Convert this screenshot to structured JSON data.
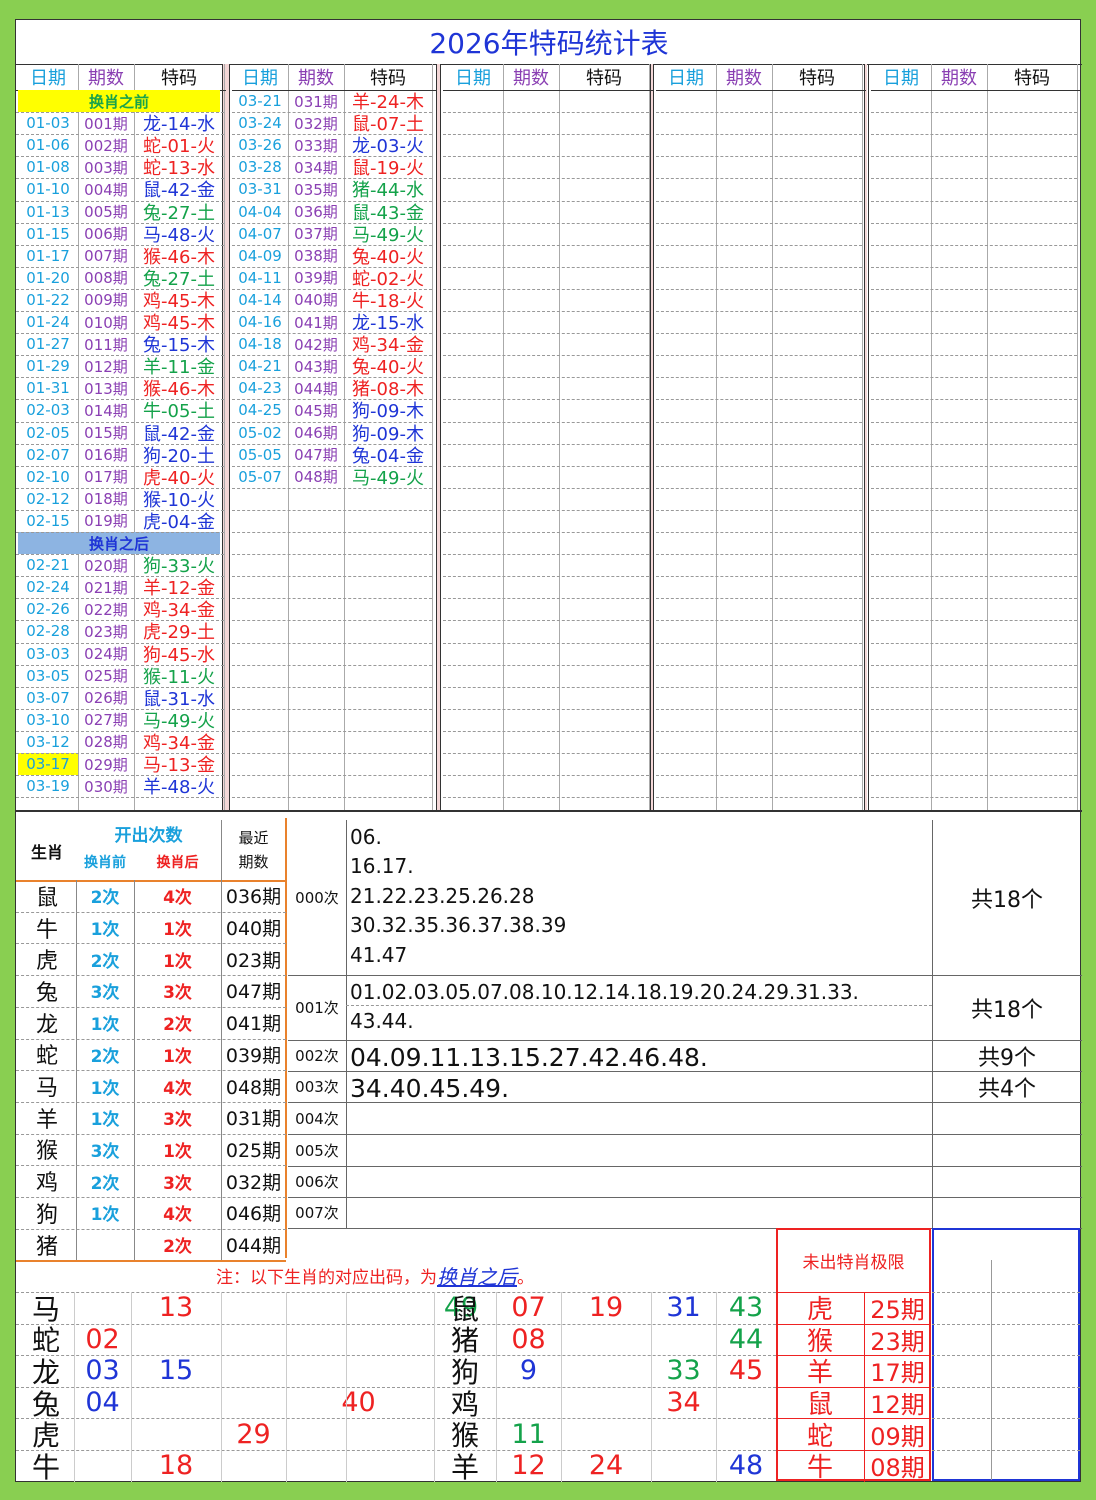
{
  "title": "2026年特码统计表",
  "header": {
    "date": "日期",
    "period": "期数",
    "code": "特码"
  },
  "banner_before": "换肖之前",
  "banner_after": "换肖之后",
  "colors": {
    "blue": "#1f35d6",
    "red": "#ee2222",
    "green": "#14a24a",
    "cyan": "#19a0dc",
    "purple": "#8a3fb3",
    "banner_yellow": "#ffff00",
    "banner_blue": "#8db4e2",
    "frame_green": "#89cf51"
  },
  "col1": [
    {
      "date": "01-03",
      "period": "001期",
      "code": "龙-14-水",
      "color": "blue"
    },
    {
      "date": "01-06",
      "period": "002期",
      "code": "蛇-01-火",
      "color": "red"
    },
    {
      "date": "01-08",
      "period": "003期",
      "code": "蛇-13-水",
      "color": "red"
    },
    {
      "date": "01-10",
      "period": "004期",
      "code": "鼠-42-金",
      "color": "blue"
    },
    {
      "date": "01-13",
      "period": "005期",
      "code": "兔-27-土",
      "color": "green"
    },
    {
      "date": "01-15",
      "period": "006期",
      "code": "马-48-火",
      "color": "blue"
    },
    {
      "date": "01-17",
      "period": "007期",
      "code": "猴-46-木",
      "color": "red"
    },
    {
      "date": "01-20",
      "period": "008期",
      "code": "兔-27-土",
      "color": "green"
    },
    {
      "date": "01-22",
      "period": "009期",
      "code": "鸡-45-木",
      "color": "red"
    },
    {
      "date": "01-24",
      "period": "010期",
      "code": "鸡-45-木",
      "color": "red"
    },
    {
      "date": "01-27",
      "period": "011期",
      "code": "兔-15-木",
      "color": "blue"
    },
    {
      "date": "01-29",
      "period": "012期",
      "code": "羊-11-金",
      "color": "green"
    },
    {
      "date": "01-31",
      "period": "013期",
      "code": "猴-46-木",
      "color": "red"
    },
    {
      "date": "02-03",
      "period": "014期",
      "code": "牛-05-土",
      "color": "green"
    },
    {
      "date": "02-05",
      "period": "015期",
      "code": "鼠-42-金",
      "color": "blue"
    },
    {
      "date": "02-07",
      "period": "016期",
      "code": "狗-20-土",
      "color": "blue"
    },
    {
      "date": "02-10",
      "period": "017期",
      "code": "虎-40-火",
      "color": "red"
    },
    {
      "date": "02-12",
      "period": "018期",
      "code": "猴-10-火",
      "color": "blue"
    },
    {
      "date": "02-15",
      "period": "019期",
      "code": "虎-04-金",
      "color": "blue"
    },
    {
      "date": "02-21",
      "period": "020期",
      "code": "狗-33-火",
      "color": "green"
    },
    {
      "date": "02-24",
      "period": "021期",
      "code": "羊-12-金",
      "color": "red"
    },
    {
      "date": "02-26",
      "period": "022期",
      "code": "鸡-34-金",
      "color": "red"
    },
    {
      "date": "02-28",
      "period": "023期",
      "code": "虎-29-土",
      "color": "red"
    },
    {
      "date": "03-03",
      "period": "024期",
      "code": "狗-45-水",
      "color": "red"
    },
    {
      "date": "03-05",
      "period": "025期",
      "code": "猴-11-火",
      "color": "green"
    },
    {
      "date": "03-07",
      "period": "026期",
      "code": "鼠-31-水",
      "color": "blue"
    },
    {
      "date": "03-10",
      "period": "027期",
      "code": "马-49-火",
      "color": "green"
    },
    {
      "date": "03-12",
      "period": "028期",
      "code": "鸡-34-金",
      "color": "red"
    },
    {
      "date": "03-17",
      "period": "029期",
      "code": "马-13-金",
      "color": "red",
      "highlight": true
    },
    {
      "date": "03-19",
      "period": "030期",
      "code": "羊-48-火",
      "color": "blue"
    }
  ],
  "col2": [
    {
      "date": "03-21",
      "period": "031期",
      "code": "羊-24-木",
      "color": "red"
    },
    {
      "date": "03-24",
      "period": "032期",
      "code": "鼠-07-土",
      "color": "red"
    },
    {
      "date": "03-26",
      "period": "033期",
      "code": "龙-03-火",
      "color": "blue"
    },
    {
      "date": "03-28",
      "period": "034期",
      "code": "鼠-19-火",
      "color": "red"
    },
    {
      "date": "03-31",
      "period": "035期",
      "code": "猪-44-水",
      "color": "green"
    },
    {
      "date": "04-04",
      "period": "036期",
      "code": "鼠-43-金",
      "color": "green"
    },
    {
      "date": "04-07",
      "period": "037期",
      "code": "马-49-火",
      "color": "green"
    },
    {
      "date": "04-09",
      "period": "038期",
      "code": "兔-40-火",
      "color": "red"
    },
    {
      "date": "04-11",
      "period": "039期",
      "code": "蛇-02-火",
      "color": "red"
    },
    {
      "date": "04-14",
      "period": "040期",
      "code": "牛-18-火",
      "color": "red"
    },
    {
      "date": "04-16",
      "period": "041期",
      "code": "龙-15-水",
      "color": "blue"
    },
    {
      "date": "04-18",
      "period": "042期",
      "code": "鸡-34-金",
      "color": "red"
    },
    {
      "date": "04-21",
      "period": "043期",
      "code": "兔-40-火",
      "color": "red"
    },
    {
      "date": "04-23",
      "period": "044期",
      "code": "猪-08-木",
      "color": "red"
    },
    {
      "date": "04-25",
      "period": "045期",
      "code": "狗-09-木",
      "color": "blue"
    },
    {
      "date": "05-02",
      "period": "046期",
      "code": "狗-09-木",
      "color": "blue"
    },
    {
      "date": "05-05",
      "period": "047期",
      "code": "兔-04-金",
      "color": "blue"
    },
    {
      "date": "05-07",
      "period": "048期",
      "code": "马-49-火",
      "color": "green"
    }
  ],
  "stats": {
    "zodiac_header": "生肖",
    "count_header": "开出次数",
    "before": "换肖前",
    "after": "换肖后",
    "recent1": "最近",
    "recent2": "期数",
    "rows": [
      {
        "z": "鼠",
        "b": "2次",
        "a": "4次",
        "r": "036期"
      },
      {
        "z": "牛",
        "b": "1次",
        "a": "1次",
        "r": "040期"
      },
      {
        "z": "虎",
        "b": "2次",
        "a": "1次",
        "r": "023期"
      },
      {
        "z": "兔",
        "b": "3次",
        "a": "3次",
        "r": "047期"
      },
      {
        "z": "龙",
        "b": "1次",
        "a": "2次",
        "r": "041期"
      },
      {
        "z": "蛇",
        "b": "2次",
        "a": "1次",
        "r": "039期"
      },
      {
        "z": "马",
        "b": "1次",
        "a": "4次",
        "r": "048期"
      },
      {
        "z": "羊",
        "b": "1次",
        "a": "3次",
        "r": "031期"
      },
      {
        "z": "猴",
        "b": "3次",
        "a": "1次",
        "r": "025期"
      },
      {
        "z": "鸡",
        "b": "2次",
        "a": "3次",
        "r": "032期"
      },
      {
        "z": "狗",
        "b": "1次",
        "a": "4次",
        "r": "046期"
      },
      {
        "z": "猪",
        "b": "",
        "a": "2次",
        "r": "044期"
      }
    ]
  },
  "freq": [
    {
      "label": "000次",
      "lines": [
        "06.",
        "16.17.",
        "21.22.23.25.26.28",
        "30.32.35.36.37.38.39",
        "41.47"
      ],
      "total": "共18个"
    },
    {
      "label": "001次",
      "lines": [
        "01.02.03.05.07.08.10.12.14.18.19.20.24.29.31.33.",
        "43.44."
      ],
      "total": "共18个"
    },
    {
      "label": "002次",
      "lines": [
        "04.09.11.13.15.27.42.46.48."
      ],
      "total": "共9个"
    },
    {
      "label": "003次",
      "lines": [
        "34.40.45.49."
      ],
      "total": "共4个"
    },
    {
      "label": "004次",
      "lines": [],
      "total": ""
    },
    {
      "label": "005次",
      "lines": [],
      "total": ""
    },
    {
      "label": "006次",
      "lines": [],
      "total": ""
    },
    {
      "label": "007次",
      "lines": [],
      "total": ""
    }
  ],
  "note_prefix": "注：以下生肖的对应出码，为",
  "note_link": "换肖之后",
  "note_suffix": "。",
  "left_grid": [
    {
      "z": "马",
      "cells": [
        [
          "",
          ""
        ],
        [
          "13",
          "red"
        ],
        [
          "",
          ""
        ],
        [
          "",
          ""
        ],
        [
          "49",
          "green"
        ]
      ]
    },
    {
      "z": "蛇",
      "cells": [
        [
          "02",
          "red"
        ],
        [
          "",
          ""
        ],
        [
          "",
          ""
        ],
        [
          "",
          ""
        ],
        [
          "",
          ""
        ]
      ]
    },
    {
      "z": "龙",
      "cells": [
        [
          "03",
          "blue"
        ],
        [
          "15",
          "blue"
        ],
        [
          "",
          ""
        ],
        [
          "",
          ""
        ],
        [
          "",
          ""
        ]
      ]
    },
    {
      "z": "兔",
      "cells": [
        [
          "04",
          "blue"
        ],
        [
          "",
          ""
        ],
        [
          "",
          ""
        ],
        [
          "40",
          "red"
        ],
        [
          "",
          ""
        ]
      ]
    },
    {
      "z": "虎",
      "cells": [
        [
          "",
          ""
        ],
        [
          "",
          ""
        ],
        [
          "29",
          "red"
        ],
        [
          "",
          ""
        ],
        [
          "",
          ""
        ]
      ]
    },
    {
      "z": "牛",
      "cells": [
        [
          "",
          ""
        ],
        [
          "18",
          "red"
        ],
        [
          "",
          ""
        ],
        [
          "",
          ""
        ],
        [
          "",
          ""
        ]
      ]
    }
  ],
  "right_grid": [
    {
      "z": "鼠",
      "cells": [
        [
          "07",
          "red"
        ],
        [
          "19",
          "red"
        ],
        [
          "31",
          "blue"
        ],
        [
          "43",
          "green"
        ]
      ]
    },
    {
      "z": "猪",
      "cells": [
        [
          "08",
          "red"
        ],
        [
          "",
          ""
        ],
        [
          "",
          ""
        ],
        [
          "44",
          "green"
        ]
      ]
    },
    {
      "z": "狗",
      "cells": [
        [
          "9",
          "blue"
        ],
        [
          "",
          ""
        ],
        [
          "33",
          "green"
        ],
        [
          "45",
          "red"
        ]
      ]
    },
    {
      "z": "鸡",
      "cells": [
        [
          "",
          ""
        ],
        [
          "",
          ""
        ],
        [
          "34",
          "red"
        ],
        [
          "",
          ""
        ]
      ]
    },
    {
      "z": "猴",
      "cells": [
        [
          "11",
          "green"
        ],
        [
          "",
          ""
        ],
        [
          "",
          ""
        ],
        [
          "",
          ""
        ]
      ]
    },
    {
      "z": "羊",
      "cells": [
        [
          "12",
          "red"
        ],
        [
          "24",
          "red"
        ],
        [
          "",
          ""
        ],
        [
          "48",
          "blue"
        ]
      ]
    }
  ],
  "limit": {
    "title": "未出特肖极限",
    "rows": [
      {
        "z": "虎",
        "p": "25期"
      },
      {
        "z": "猴",
        "p": "23期"
      },
      {
        "z": "羊",
        "p": "17期"
      },
      {
        "z": "鼠",
        "p": "12期"
      },
      {
        "z": "蛇",
        "p": "09期"
      },
      {
        "z": "牛",
        "p": "08期"
      }
    ]
  }
}
